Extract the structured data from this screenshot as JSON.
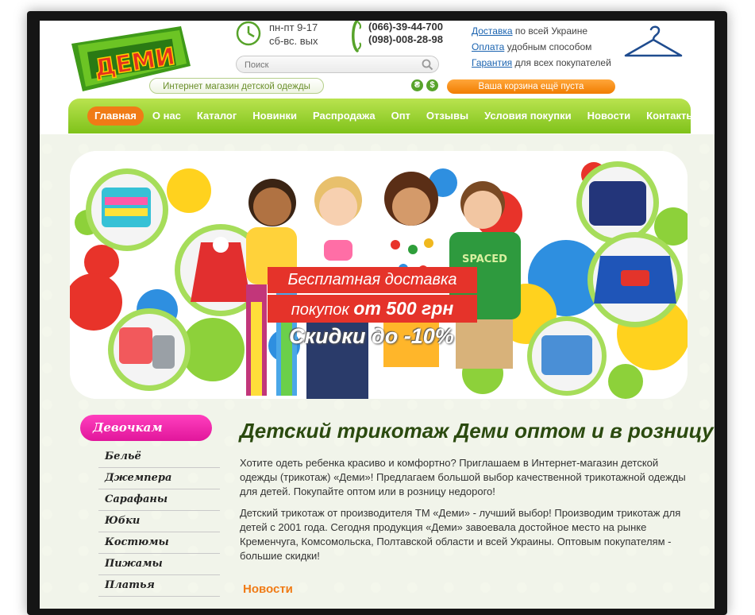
{
  "header": {
    "logo_text": "ДЕМИ",
    "slogan": "Интернет магазин детской одежды",
    "hours": [
      "пн-пт 9-17",
      "сб-вс. вых"
    ],
    "phones": [
      "(066)-39-44-700",
      "(098)-008-28-98"
    ],
    "search_placeholder": "Поиск",
    "currency": [
      "₴",
      "$"
    ],
    "cart_label": "Ваша корзина ещё пуста",
    "info": [
      {
        "link": "Доставка",
        "text": " по всей Украине"
      },
      {
        "link": "Оплата",
        "text": " удобным способом"
      },
      {
        "link": "Гарантия",
        "text": " для всех покупателей"
      }
    ]
  },
  "nav": {
    "items": [
      "Главная",
      "О нас",
      "Каталог",
      "Новинки",
      "Распродажа",
      "Опт",
      "Отзывы",
      "Условия покупки",
      "Новости",
      "Контакты"
    ]
  },
  "banner": {
    "line1": "Бесплатная доставка",
    "line2_prefix": "покупок ",
    "line2_value": "от 500 грн",
    "line3": "Скидки до -10%"
  },
  "sidebar": {
    "title": "Девочкам",
    "items": [
      "Бельё",
      "Джемпера",
      "Сарафаны",
      "Юбки",
      "Костюмы",
      "Пижамы",
      "Платья"
    ]
  },
  "main": {
    "title": "Детский трикотаж Деми оптом и в розницу",
    "paragraphs": [
      "Хотите одеть ребенка красиво и комфортно? Приглашаем в Интернет-магазин детской одежды (трикотаж) «Деми»! Предлагаем большой выбор качественной трикотажной одежды для детей. Покупайте оптом или в розницу недорого!",
      "Детский трикотаж от производителя ТМ «Деми» - лучший выбор! Производим трикотаж для детей с 2001 года. Сегодня продукция «Деми» завоевала достойное место на рынке Кременчуга, Комсомольска, Полтавской области и всей Украины. Оптовым покупателям - большие скидки!"
    ],
    "news_heading": "Новости"
  },
  "colors": {
    "nav_green": "#8fd12a",
    "accent_orange": "#f07b16",
    "category_pink": "#e1169b",
    "promo_red": "#e5332a",
    "title_green": "#2b4a0f",
    "link_blue": "#1a63b0"
  },
  "icons": [
    "clock-icon",
    "phone-icon",
    "search-icon",
    "hanger-icon"
  ]
}
